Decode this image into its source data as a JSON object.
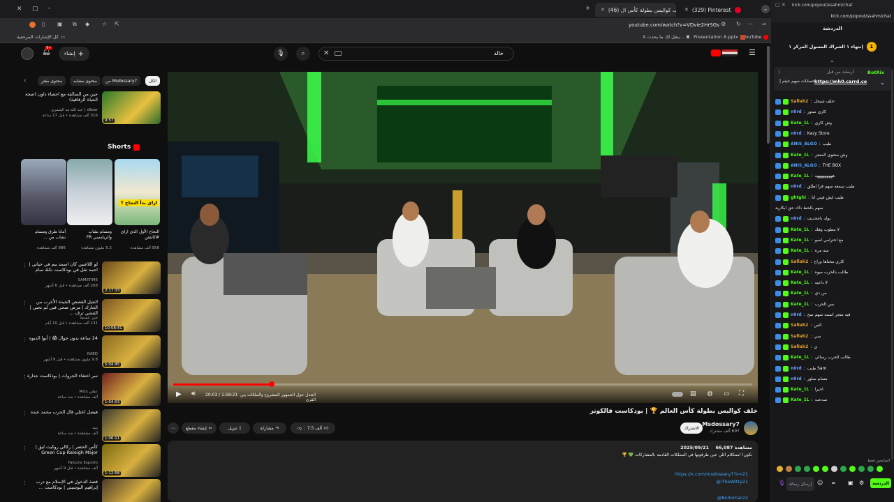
{
  "browser": {
    "tabs": [
      {
        "label": "(329) Pinterest",
        "fav": "#e60023"
      },
      {
        "label": "(46) خلف كواليس بطولة كأس ال",
        "fav": "#ff0000"
      }
    ],
    "address": "youtube.com/watch?v=VDvie2HrSGs",
    "bookmarks": [
      {
        "label": "كل الإشارات المرجعية"
      },
      {
        "label": "YouTube"
      },
      {
        "label": "Presentation 8.pptx"
      },
      {
        "label": "X يتقل لك ما يحدث..."
      }
    ]
  },
  "youtube": {
    "search_value": "خالد",
    "create_label": "إنشاء",
    "notif_count": "9+",
    "chips": [
      "الكل",
      "من Msdossary7",
      "محتوى مشابه",
      "محتوى مقتر"
    ],
    "shorts_title": "Shorts",
    "shorts": [
      {
        "title": "النجاح الأول الذي ازاي #كابتقن",
        "meta": "956 ألف مشاهدة",
        "caption": "ازاي بدأ النجاح ؟"
      },
      {
        "title": "ومسام نشاب والريامسي FR",
        "meta": "5.2 مليون مشاهدة",
        "caption": ""
      },
      {
        "title": "أمانا طرق ومسام نشاب من ...",
        "meta": "986 ألف مشاهدة",
        "caption": ""
      }
    ],
    "top_video": {
      "title": "جين من السالفة مع احصاء داون (صحة الحياة الرقاقية)",
      "channel": "xBear | عبد الله مد الشمري",
      "meta": "316 ألف مشاهدة • قبل 17 ساعة",
      "duration": "9:57"
    },
    "videos": [
      {
        "title": "لو اللاعبين كان اسمد يبم في حياتي | احمد تقل في بودكاست تكلة سام",
        "channel": "SAM6TiME",
        "meta": "268 ألف مشاهدة • قبل 6 أشهر",
        "duration": "2:17:33",
        "bg": "#6a4a1a"
      },
      {
        "title": "الجيل القصص الجيدة الأعرب من الحارك | مرض صحي قبي لم تحني | القشي ترف ...",
        "channel": "جين عسنية",
        "meta": "131 ألف مشاهدة • قبل 10 أيام",
        "duration": "10:58:41",
        "bg": "#7a5520"
      },
      {
        "title": "24 ساعة بدون جوال 😱 | أيوا الديوه",
        "channel": "RAED",
        "meta": "9.8 مليون مشاهدة • قبل 9 أشهر",
        "duration": "5:04:45",
        "bg": "#8a6a20"
      },
      {
        "title": "سر اختفاء الجروات | بودكاست جدارة",
        "channel": "عقلي Mics",
        "meta": "ألف مشاهدة • منذ ساعة",
        "duration": "1:04:03",
        "bg": "#702020"
      },
      {
        "title": "فيصل اعتلي قال الحرب محمد عبده",
        "channel": "نبيه",
        "meta": "ألف مشاهدة • منذ ساعة",
        "duration": "1:06:11",
        "bg": "#3a3a30"
      },
      {
        "title": "كأس الخضر | ركالي روكيت ليق | Green Cup Raleigh Major",
        "channel": "Falcons Esports",
        "meta": "ألف مشاهدة • قبل 9 أشهر",
        "duration": "1:12:58",
        "bg": "#7a6a10"
      },
      {
        "title": "قصة الدخول في الإسلام مع درب إبراهيم البوسيني | بودكاست ...",
        "channel": "",
        "meta": "",
        "duration": "",
        "bg": "#4a3a2a"
      }
    ],
    "player": {
      "time": "20:03 / 1:58:21",
      "chapter": "الجدل حول الجمهور المشروع والملكات بين القرى",
      "progress": 0.17
    },
    "video_title": "خلف كواليس بطولة كأس العالم 🏆 | بودكاست فالكونز",
    "channel_name": "Msdossary7",
    "subs": "697 ألف مشترك",
    "subscribe_label": "الاشتراك",
    "likes": "7.5 ألف",
    "share_label": "مشاركة",
    "download_label": "تنزيل",
    "clip_label": "إنشاء مقطع",
    "views": "66,087 مشاهدة",
    "date": "2025/09/21",
    "desc_line": "نكون! استكلام اللي عين طرقونها في المملكات القادمة بالمشاركات 💚 🏆",
    "links": [
      "https://x.com/msdossary7?s=21",
      "@iTheWitty21",
      "@Bo3omar22"
    ]
  },
  "chat": {
    "url": "kick.com/popout/ssahm/chat",
    "title": "الدردشة",
    "pinned": "إنتهاء ١ الشراك المسول المركز ١",
    "pinned_rank": "1",
    "bot_name": "BotRix",
    "bot_msg": "أرسلت من قبل",
    "bot_link": "https://mh0.carrd.co",
    "bot_desc": "حسابات سهم حيثم |",
    "messages": [
      {
        "user": "Safiah2",
        "text": "خلف شيخل:",
        "color": "#e0a030"
      },
      {
        "user": "n0rd",
        "text": "كازي ستور",
        "color": "#6da0ff"
      },
      {
        "user": "Kate_1L",
        "text": "وش كازي",
        "color": "#53fc18"
      },
      {
        "user": "n0rd",
        "text": "Kazy Store",
        "color": "#6da0ff"
      },
      {
        "user": "ANIS_ALGO",
        "text": "طيب",
        "color": "#4aa3ff"
      },
      {
        "user": "Kate_1L",
        "text": "وش محتوى المتجر",
        "color": "#53fc18"
      },
      {
        "user": "ANIS_ALGO",
        "text": "THE BOX",
        "color": "#4aa3ff"
      },
      {
        "user": "Kate_1L",
        "text": "هههههههههه",
        "color": "#53fc18"
      },
      {
        "user": "n0rd",
        "text": "طيب سمعه سهم قرأ اطلق",
        "color": "#6da0ff"
      },
      {
        "user": "ghtghi",
        "text": "طيب ايش فيني انا",
        "color": "#53fc18"
      },
      {
        "user": "",
        "text": "سهم بالحظ ذاك حق ابكارية",
        "color": "#efeff1"
      },
      {
        "user": "n0rd",
        "text": "يولد باجحديث",
        "color": "#6da0ff"
      },
      {
        "user": "Kate_1L",
        "text": "لا مطوب وهك",
        "color": "#53fc18"
      },
      {
        "user": "Kate_1L",
        "text": "مع احترامي لسو",
        "color": "#53fc18"
      },
      {
        "user": "Kate_1L",
        "text": "ميه مره",
        "color": "#53fc18"
      },
      {
        "user": "Safiah2",
        "text": "كاري محناها وراح",
        "color": "#e0a030"
      },
      {
        "user": "Kate_1L",
        "text": "طالب بالحرب ميوه",
        "color": "#53fc18"
      },
      {
        "user": "Kate_1L",
        "text": "لا داعيه",
        "color": "#53fc18"
      },
      {
        "user": "Kate_1L",
        "text": "من ذي",
        "color": "#53fc18"
      },
      {
        "user": "Kate_1L",
        "text": "بس الحرب",
        "color": "#53fc18"
      },
      {
        "user": "n0rd",
        "text": "فيه متجر اسمه سهم سح",
        "color": "#6da0ff"
      },
      {
        "user": "Safiah2",
        "text": "الس",
        "color": "#e0a030"
      },
      {
        "user": "Safiah2",
        "text": "سي",
        "color": "#e0a030"
      },
      {
        "user": "Safiah2",
        "text": "ي",
        "color": "#e0a030"
      },
      {
        "user": "Kate_1L",
        "text": "طالب الحرب رسالي",
        "color": "#53fc18"
      },
      {
        "user": "n0rd",
        "text": "طيب Sam",
        "color": "#6da0ff"
      },
      {
        "user": "n0rd",
        "text": "مسام سلور",
        "color": "#6da0ff"
      },
      {
        "user": "Kate_1L",
        "text": "اخيرا",
        "color": "#53fc18"
      },
      {
        "user": "Kate_1L",
        "text": "صدعت",
        "color": "#53fc18"
      }
    ],
    "active_label": "المتابعين فقط",
    "input_placeholder": "إرسال رسالة",
    "send_label": "الدردشة"
  }
}
